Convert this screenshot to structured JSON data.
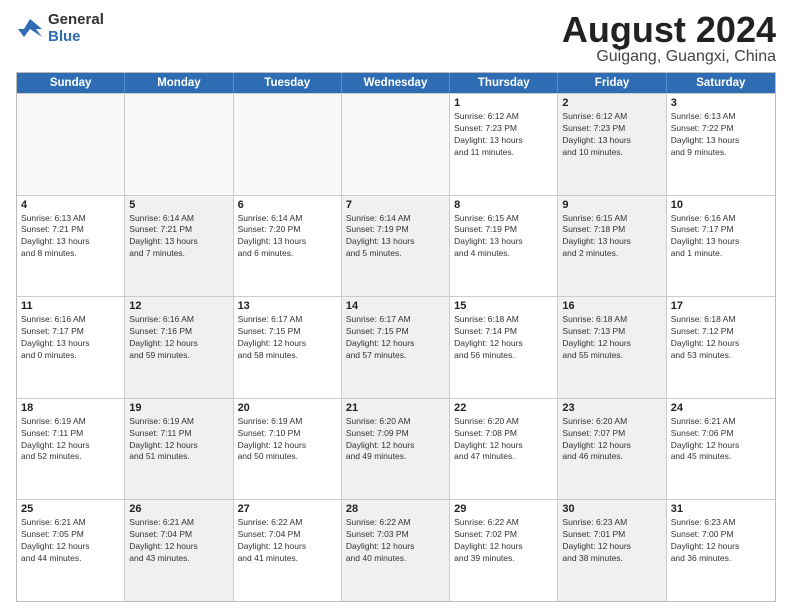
{
  "logo": {
    "general": "General",
    "blue": "Blue"
  },
  "title": "August 2024",
  "subtitle": "Guigang, Guangxi, China",
  "weekdays": [
    "Sunday",
    "Monday",
    "Tuesday",
    "Wednesday",
    "Thursday",
    "Friday",
    "Saturday"
  ],
  "rows": [
    [
      {
        "day": "",
        "info": "",
        "empty": true
      },
      {
        "day": "",
        "info": "",
        "empty": true
      },
      {
        "day": "",
        "info": "",
        "empty": true
      },
      {
        "day": "",
        "info": "",
        "empty": true
      },
      {
        "day": "1",
        "info": "Sunrise: 6:12 AM\nSunset: 7:23 PM\nDaylight: 13 hours\nand 11 minutes."
      },
      {
        "day": "2",
        "info": "Sunrise: 6:12 AM\nSunset: 7:23 PM\nDaylight: 13 hours\nand 10 minutes.",
        "shaded": true
      },
      {
        "day": "3",
        "info": "Sunrise: 6:13 AM\nSunset: 7:22 PM\nDaylight: 13 hours\nand 9 minutes."
      }
    ],
    [
      {
        "day": "4",
        "info": "Sunrise: 6:13 AM\nSunset: 7:21 PM\nDaylight: 13 hours\nand 8 minutes."
      },
      {
        "day": "5",
        "info": "Sunrise: 6:14 AM\nSunset: 7:21 PM\nDaylight: 13 hours\nand 7 minutes.",
        "shaded": true
      },
      {
        "day": "6",
        "info": "Sunrise: 6:14 AM\nSunset: 7:20 PM\nDaylight: 13 hours\nand 6 minutes."
      },
      {
        "day": "7",
        "info": "Sunrise: 6:14 AM\nSunset: 7:19 PM\nDaylight: 13 hours\nand 5 minutes.",
        "shaded": true
      },
      {
        "day": "8",
        "info": "Sunrise: 6:15 AM\nSunset: 7:19 PM\nDaylight: 13 hours\nand 4 minutes."
      },
      {
        "day": "9",
        "info": "Sunrise: 6:15 AM\nSunset: 7:18 PM\nDaylight: 13 hours\nand 2 minutes.",
        "shaded": true
      },
      {
        "day": "10",
        "info": "Sunrise: 6:16 AM\nSunset: 7:17 PM\nDaylight: 13 hours\nand 1 minute."
      }
    ],
    [
      {
        "day": "11",
        "info": "Sunrise: 6:16 AM\nSunset: 7:17 PM\nDaylight: 13 hours\nand 0 minutes."
      },
      {
        "day": "12",
        "info": "Sunrise: 6:16 AM\nSunset: 7:16 PM\nDaylight: 12 hours\nand 59 minutes.",
        "shaded": true
      },
      {
        "day": "13",
        "info": "Sunrise: 6:17 AM\nSunset: 7:15 PM\nDaylight: 12 hours\nand 58 minutes."
      },
      {
        "day": "14",
        "info": "Sunrise: 6:17 AM\nSunset: 7:15 PM\nDaylight: 12 hours\nand 57 minutes.",
        "shaded": true
      },
      {
        "day": "15",
        "info": "Sunrise: 6:18 AM\nSunset: 7:14 PM\nDaylight: 12 hours\nand 56 minutes."
      },
      {
        "day": "16",
        "info": "Sunrise: 6:18 AM\nSunset: 7:13 PM\nDaylight: 12 hours\nand 55 minutes.",
        "shaded": true
      },
      {
        "day": "17",
        "info": "Sunrise: 6:18 AM\nSunset: 7:12 PM\nDaylight: 12 hours\nand 53 minutes."
      }
    ],
    [
      {
        "day": "18",
        "info": "Sunrise: 6:19 AM\nSunset: 7:11 PM\nDaylight: 12 hours\nand 52 minutes."
      },
      {
        "day": "19",
        "info": "Sunrise: 6:19 AM\nSunset: 7:11 PM\nDaylight: 12 hours\nand 51 minutes.",
        "shaded": true
      },
      {
        "day": "20",
        "info": "Sunrise: 6:19 AM\nSunset: 7:10 PM\nDaylight: 12 hours\nand 50 minutes."
      },
      {
        "day": "21",
        "info": "Sunrise: 6:20 AM\nSunset: 7:09 PM\nDaylight: 12 hours\nand 49 minutes.",
        "shaded": true
      },
      {
        "day": "22",
        "info": "Sunrise: 6:20 AM\nSunset: 7:08 PM\nDaylight: 12 hours\nand 47 minutes."
      },
      {
        "day": "23",
        "info": "Sunrise: 6:20 AM\nSunset: 7:07 PM\nDaylight: 12 hours\nand 46 minutes.",
        "shaded": true
      },
      {
        "day": "24",
        "info": "Sunrise: 6:21 AM\nSunset: 7:06 PM\nDaylight: 12 hours\nand 45 minutes."
      }
    ],
    [
      {
        "day": "25",
        "info": "Sunrise: 6:21 AM\nSunset: 7:05 PM\nDaylight: 12 hours\nand 44 minutes."
      },
      {
        "day": "26",
        "info": "Sunrise: 6:21 AM\nSunset: 7:04 PM\nDaylight: 12 hours\nand 43 minutes.",
        "shaded": true
      },
      {
        "day": "27",
        "info": "Sunrise: 6:22 AM\nSunset: 7:04 PM\nDaylight: 12 hours\nand 41 minutes."
      },
      {
        "day": "28",
        "info": "Sunrise: 6:22 AM\nSunset: 7:03 PM\nDaylight: 12 hours\nand 40 minutes.",
        "shaded": true
      },
      {
        "day": "29",
        "info": "Sunrise: 6:22 AM\nSunset: 7:02 PM\nDaylight: 12 hours\nand 39 minutes."
      },
      {
        "day": "30",
        "info": "Sunrise: 6:23 AM\nSunset: 7:01 PM\nDaylight: 12 hours\nand 38 minutes.",
        "shaded": true
      },
      {
        "day": "31",
        "info": "Sunrise: 6:23 AM\nSunset: 7:00 PM\nDaylight: 12 hours\nand 36 minutes."
      }
    ]
  ]
}
